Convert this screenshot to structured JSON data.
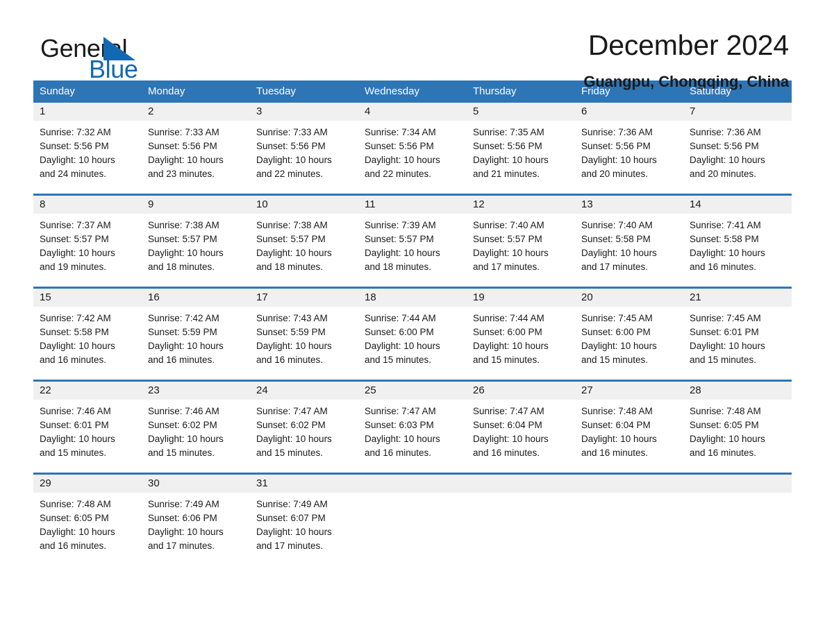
{
  "brand": {
    "word1": "General",
    "word2": "Blue",
    "triangle_color": "#1268b3",
    "icon": "triangle-logo-icon"
  },
  "header": {
    "title": "December 2024",
    "subtitle": "Guangpu, Chongqing, China"
  },
  "theme": {
    "header_blue": "#2e75b6",
    "row_rule_blue": "#2e75b6",
    "date_band_gray": "#f0f0f0",
    "text_color": "#1a1a1a"
  },
  "calendar": {
    "weekdays": [
      "Sunday",
      "Monday",
      "Tuesday",
      "Wednesday",
      "Thursday",
      "Friday",
      "Saturday"
    ],
    "weeks": [
      [
        {
          "day": "1",
          "sunrise": "Sunrise: 7:32 AM",
          "sunset": "Sunset: 5:56 PM",
          "daylight1": "Daylight: 10 hours",
          "daylight2": "and 24 minutes."
        },
        {
          "day": "2",
          "sunrise": "Sunrise: 7:33 AM",
          "sunset": "Sunset: 5:56 PM",
          "daylight1": "Daylight: 10 hours",
          "daylight2": "and 23 minutes."
        },
        {
          "day": "3",
          "sunrise": "Sunrise: 7:33 AM",
          "sunset": "Sunset: 5:56 PM",
          "daylight1": "Daylight: 10 hours",
          "daylight2": "and 22 minutes."
        },
        {
          "day": "4",
          "sunrise": "Sunrise: 7:34 AM",
          "sunset": "Sunset: 5:56 PM",
          "daylight1": "Daylight: 10 hours",
          "daylight2": "and 22 minutes."
        },
        {
          "day": "5",
          "sunrise": "Sunrise: 7:35 AM",
          "sunset": "Sunset: 5:56 PM",
          "daylight1": "Daylight: 10 hours",
          "daylight2": "and 21 minutes."
        },
        {
          "day": "6",
          "sunrise": "Sunrise: 7:36 AM",
          "sunset": "Sunset: 5:56 PM",
          "daylight1": "Daylight: 10 hours",
          "daylight2": "and 20 minutes."
        },
        {
          "day": "7",
          "sunrise": "Sunrise: 7:36 AM",
          "sunset": "Sunset: 5:56 PM",
          "daylight1": "Daylight: 10 hours",
          "daylight2": "and 20 minutes."
        }
      ],
      [
        {
          "day": "8",
          "sunrise": "Sunrise: 7:37 AM",
          "sunset": "Sunset: 5:57 PM",
          "daylight1": "Daylight: 10 hours",
          "daylight2": "and 19 minutes."
        },
        {
          "day": "9",
          "sunrise": "Sunrise: 7:38 AM",
          "sunset": "Sunset: 5:57 PM",
          "daylight1": "Daylight: 10 hours",
          "daylight2": "and 18 minutes."
        },
        {
          "day": "10",
          "sunrise": "Sunrise: 7:38 AM",
          "sunset": "Sunset: 5:57 PM",
          "daylight1": "Daylight: 10 hours",
          "daylight2": "and 18 minutes."
        },
        {
          "day": "11",
          "sunrise": "Sunrise: 7:39 AM",
          "sunset": "Sunset: 5:57 PM",
          "daylight1": "Daylight: 10 hours",
          "daylight2": "and 18 minutes."
        },
        {
          "day": "12",
          "sunrise": "Sunrise: 7:40 AM",
          "sunset": "Sunset: 5:57 PM",
          "daylight1": "Daylight: 10 hours",
          "daylight2": "and 17 minutes."
        },
        {
          "day": "13",
          "sunrise": "Sunrise: 7:40 AM",
          "sunset": "Sunset: 5:58 PM",
          "daylight1": "Daylight: 10 hours",
          "daylight2": "and 17 minutes."
        },
        {
          "day": "14",
          "sunrise": "Sunrise: 7:41 AM",
          "sunset": "Sunset: 5:58 PM",
          "daylight1": "Daylight: 10 hours",
          "daylight2": "and 16 minutes."
        }
      ],
      [
        {
          "day": "15",
          "sunrise": "Sunrise: 7:42 AM",
          "sunset": "Sunset: 5:58 PM",
          "daylight1": "Daylight: 10 hours",
          "daylight2": "and 16 minutes."
        },
        {
          "day": "16",
          "sunrise": "Sunrise: 7:42 AM",
          "sunset": "Sunset: 5:59 PM",
          "daylight1": "Daylight: 10 hours",
          "daylight2": "and 16 minutes."
        },
        {
          "day": "17",
          "sunrise": "Sunrise: 7:43 AM",
          "sunset": "Sunset: 5:59 PM",
          "daylight1": "Daylight: 10 hours",
          "daylight2": "and 16 minutes."
        },
        {
          "day": "18",
          "sunrise": "Sunrise: 7:44 AM",
          "sunset": "Sunset: 6:00 PM",
          "daylight1": "Daylight: 10 hours",
          "daylight2": "and 15 minutes."
        },
        {
          "day": "19",
          "sunrise": "Sunrise: 7:44 AM",
          "sunset": "Sunset: 6:00 PM",
          "daylight1": "Daylight: 10 hours",
          "daylight2": "and 15 minutes."
        },
        {
          "day": "20",
          "sunrise": "Sunrise: 7:45 AM",
          "sunset": "Sunset: 6:00 PM",
          "daylight1": "Daylight: 10 hours",
          "daylight2": "and 15 minutes."
        },
        {
          "day": "21",
          "sunrise": "Sunrise: 7:45 AM",
          "sunset": "Sunset: 6:01 PM",
          "daylight1": "Daylight: 10 hours",
          "daylight2": "and 15 minutes."
        }
      ],
      [
        {
          "day": "22",
          "sunrise": "Sunrise: 7:46 AM",
          "sunset": "Sunset: 6:01 PM",
          "daylight1": "Daylight: 10 hours",
          "daylight2": "and 15 minutes."
        },
        {
          "day": "23",
          "sunrise": "Sunrise: 7:46 AM",
          "sunset": "Sunset: 6:02 PM",
          "daylight1": "Daylight: 10 hours",
          "daylight2": "and 15 minutes."
        },
        {
          "day": "24",
          "sunrise": "Sunrise: 7:47 AM",
          "sunset": "Sunset: 6:02 PM",
          "daylight1": "Daylight: 10 hours",
          "daylight2": "and 15 minutes."
        },
        {
          "day": "25",
          "sunrise": "Sunrise: 7:47 AM",
          "sunset": "Sunset: 6:03 PM",
          "daylight1": "Daylight: 10 hours",
          "daylight2": "and 16 minutes."
        },
        {
          "day": "26",
          "sunrise": "Sunrise: 7:47 AM",
          "sunset": "Sunset: 6:04 PM",
          "daylight1": "Daylight: 10 hours",
          "daylight2": "and 16 minutes."
        },
        {
          "day": "27",
          "sunrise": "Sunrise: 7:48 AM",
          "sunset": "Sunset: 6:04 PM",
          "daylight1": "Daylight: 10 hours",
          "daylight2": "and 16 minutes."
        },
        {
          "day": "28",
          "sunrise": "Sunrise: 7:48 AM",
          "sunset": "Sunset: 6:05 PM",
          "daylight1": "Daylight: 10 hours",
          "daylight2": "and 16 minutes."
        }
      ],
      [
        {
          "day": "29",
          "sunrise": "Sunrise: 7:48 AM",
          "sunset": "Sunset: 6:05 PM",
          "daylight1": "Daylight: 10 hours",
          "daylight2": "and 16 minutes."
        },
        {
          "day": "30",
          "sunrise": "Sunrise: 7:49 AM",
          "sunset": "Sunset: 6:06 PM",
          "daylight1": "Daylight: 10 hours",
          "daylight2": "and 17 minutes."
        },
        {
          "day": "31",
          "sunrise": "Sunrise: 7:49 AM",
          "sunset": "Sunset: 6:07 PM",
          "daylight1": "Daylight: 10 hours",
          "daylight2": "and 17 minutes."
        },
        {
          "day": "",
          "sunrise": "",
          "sunset": "",
          "daylight1": "",
          "daylight2": ""
        },
        {
          "day": "",
          "sunrise": "",
          "sunset": "",
          "daylight1": "",
          "daylight2": ""
        },
        {
          "day": "",
          "sunrise": "",
          "sunset": "",
          "daylight1": "",
          "daylight2": ""
        },
        {
          "day": "",
          "sunrise": "",
          "sunset": "",
          "daylight1": "",
          "daylight2": ""
        }
      ]
    ]
  }
}
